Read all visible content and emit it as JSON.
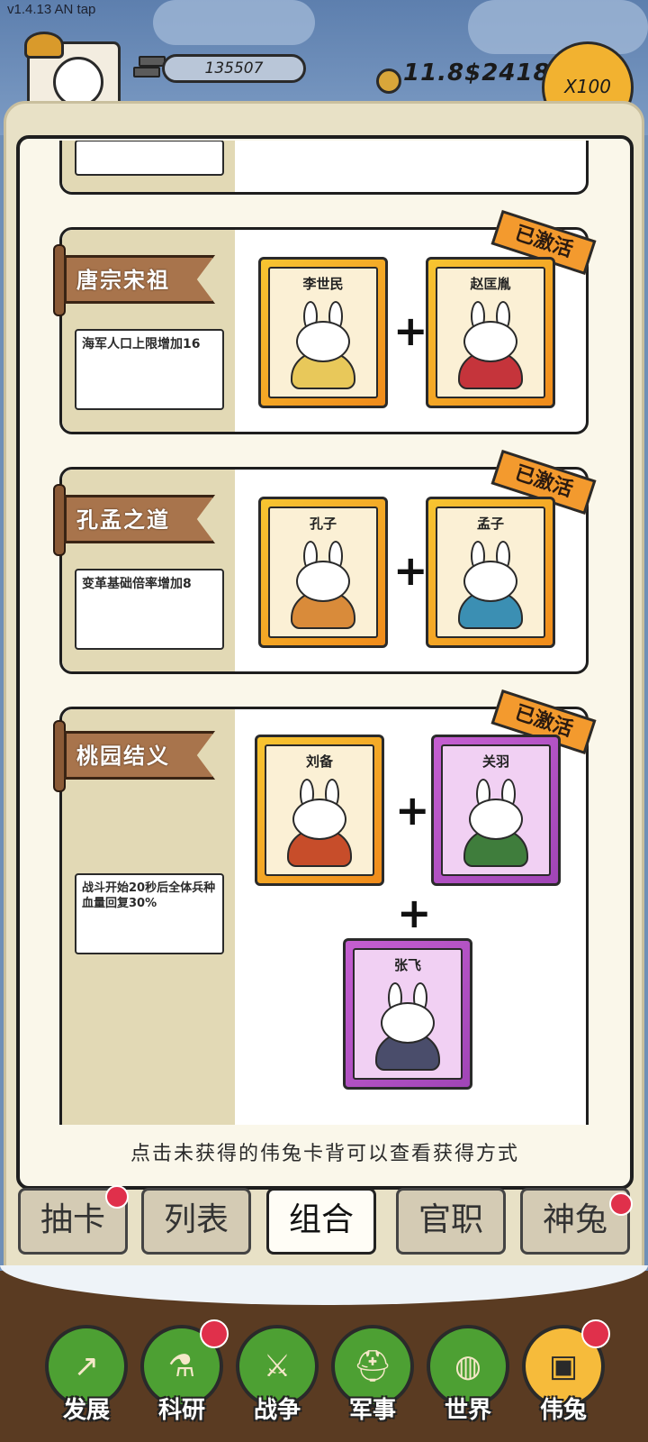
{
  "version": "v1.4.13 AN tap",
  "hud": {
    "silver": "135507",
    "gold": "11.8",
    "money": "$2418",
    "multiplier": "X100"
  },
  "combos": [
    {
      "name": "唐宗宋祖",
      "effect": "海军人口上限增加16",
      "status": "已激活",
      "cards": [
        {
          "name": "李世民",
          "rarity": "gold",
          "robe": "#e8c85a"
        },
        {
          "name": "赵匡胤",
          "rarity": "gold",
          "robe": "#c5343b"
        }
      ]
    },
    {
      "name": "孔孟之道",
      "effect": "变革基础倍率增加8",
      "status": "已激活",
      "cards": [
        {
          "name": "孔子",
          "rarity": "gold",
          "robe": "#d98b3a"
        },
        {
          "name": "孟子",
          "rarity": "gold",
          "robe": "#3b8fb3"
        }
      ]
    },
    {
      "name": "桃园结义",
      "effect": "战斗开始20秒后全体兵种血量回复30%",
      "status": "已激活",
      "cards": [
        {
          "name": "刘备",
          "rarity": "gold",
          "robe": "#c74d2a"
        },
        {
          "name": "关羽",
          "rarity": "purple",
          "robe": "#3f7d3c"
        },
        {
          "name": "张飞",
          "rarity": "purple",
          "robe": "#4a4d6b"
        }
      ]
    }
  ],
  "hint": "点击未获得的伟兔卡背可以查看获得方式",
  "tabs": [
    {
      "label": "抽卡",
      "badge": true
    },
    {
      "label": "列表",
      "badge": false
    },
    {
      "label": "组合",
      "badge": false,
      "active": true
    },
    {
      "label": "官职",
      "badge": false
    },
    {
      "label": "神兔",
      "badge": true
    }
  ],
  "nav": [
    {
      "label": "发展",
      "icon": "arrow-up-icon",
      "glyph": "↗",
      "badge": false
    },
    {
      "label": "科研",
      "icon": "flask-icon",
      "glyph": "⚗",
      "badge": true
    },
    {
      "label": "战争",
      "icon": "crossed-swords-icon",
      "glyph": "⚔",
      "badge": false
    },
    {
      "label": "军事",
      "icon": "helmet-icon",
      "glyph": "⛑",
      "badge": false
    },
    {
      "label": "世界",
      "icon": "globe-icon",
      "glyph": "◍",
      "badge": false
    },
    {
      "label": "伟兔",
      "icon": "card-icon",
      "glyph": "▣",
      "badge": true,
      "active": true
    }
  ]
}
